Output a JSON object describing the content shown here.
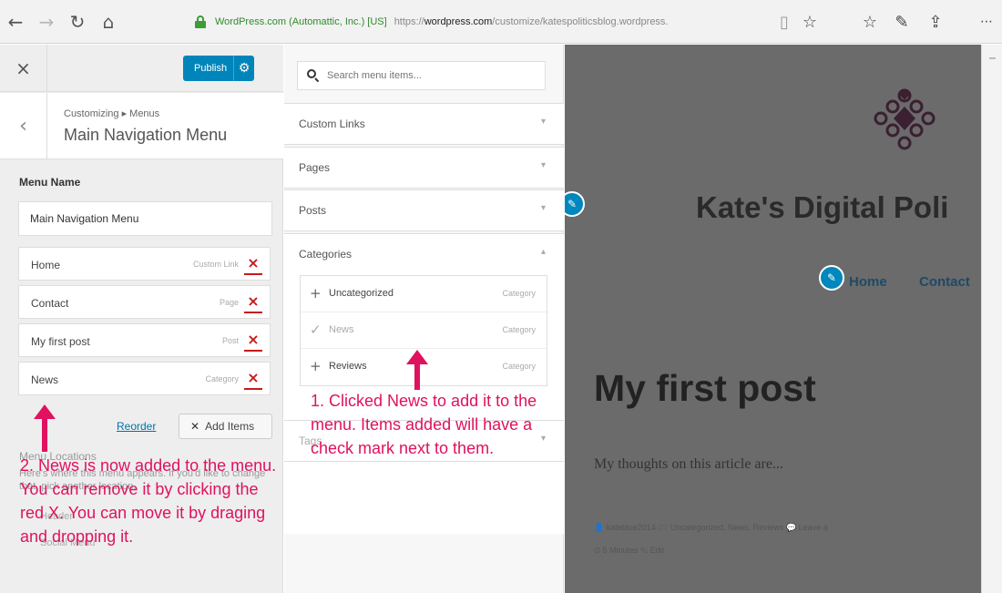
{
  "browser": {
    "back_icon": "arrow-left-icon",
    "forward_icon": "arrow-right-icon",
    "site_identity": "WordPress.com (Automattic, Inc.) [US]",
    "url_scheme": "https://",
    "url_host": "wordpress.com",
    "url_path": "/customize/katespoliticsblog.wordpress."
  },
  "customizer": {
    "close_label": "×",
    "publish_label": "Publish",
    "back_label": "‹",
    "breadcrumb": "Customizing ▸ Menus",
    "panel_title": "Main Navigation Menu",
    "menu_name_label": "Menu Name",
    "menu_name_value": "Main Navigation Menu",
    "menu_items": [
      {
        "title": "Home",
        "type": "Custom Link"
      },
      {
        "title": "Contact",
        "type": "Page"
      },
      {
        "title": "My first post",
        "type": "Post"
      },
      {
        "title": "News",
        "type": "Category"
      }
    ],
    "remove_glyph": "×",
    "reorder_label": "Reorder",
    "add_items_label": "Add Items",
    "menu_locations_label": "Menu Locations",
    "menu_locations_desc": "Here's where this menu appears. If you'd like to change that, pick another location.",
    "location_header": "Header",
    "location_social": "Social Menu"
  },
  "available": {
    "search_placeholder": "Search menu items...",
    "sections": [
      {
        "title": "Custom Links",
        "arrow": "▾"
      },
      {
        "title": "Pages",
        "arrow": "▾"
      },
      {
        "title": "Posts",
        "arrow": "▾"
      },
      {
        "title": "Categories",
        "arrow": "▴"
      },
      {
        "title": "Tags",
        "arrow": "▾"
      }
    ],
    "categories": [
      {
        "title": "Uncategorized",
        "type": "Category",
        "icon": "plus-icon",
        "glyph": "+"
      },
      {
        "title": "News",
        "type": "Category",
        "icon": "checkmark-icon",
        "glyph": "✓"
      },
      {
        "title": "Reviews",
        "type": "Category",
        "icon": "plus-icon",
        "glyph": "+"
      }
    ]
  },
  "preview": {
    "site_title": "Kate's Digital Poli",
    "nav": [
      "Home",
      "Contact"
    ],
    "post_title": "My first post",
    "post_excerpt": "My thoughts on this article are...",
    "meta_line1": "👤 kateblue2014   🗁 Uncategorized, News, Reviews   💬 Leave a",
    "meta_line2": "⏲ 5 Minutes   ✎ Edit"
  },
  "annotations": {
    "step1": "1. Clicked News to add it to the menu. Items added will have a check mark next to them.",
    "step2": "2. News is now added to the menu. You can remove it by clicking the red X. You can move it by draging and dropping it."
  },
  "colors": {
    "accent_blue": "#0085ba",
    "annotation_pink": "#e0115f",
    "remove_red": "#c51a1a",
    "preview_bg": "#6b6b6b"
  }
}
